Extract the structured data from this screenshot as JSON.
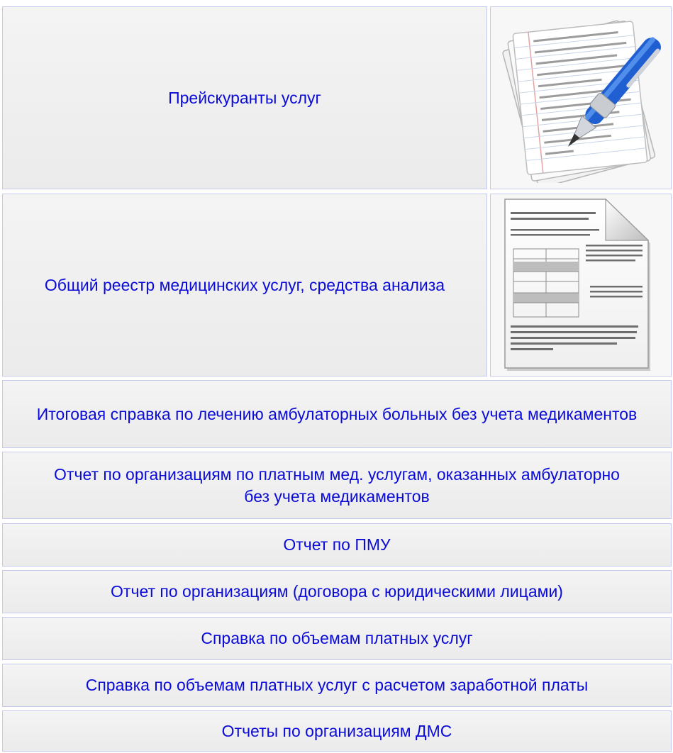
{
  "menu": {
    "items": [
      {
        "label": "Прейскуранты услуг"
      },
      {
        "label": "Общий реестр медицинских услуг, средства анализа"
      },
      {
        "label": "Итоговая справка по лечению амбулаторных больных без учета медикаментов"
      },
      {
        "label": "Отчет по организациям по платным мед. услугам, оказанных амбулаторно без учета медикаментов"
      },
      {
        "label": "Отчет по ПМУ"
      },
      {
        "label": "Отчет по организациям (договора с юридическими лицами)"
      },
      {
        "label": "Справка по объемам платных услуг"
      },
      {
        "label": "Справка по объемам платных услуг с расчетом заработной платы"
      },
      {
        "label": "Отчеты по организациям ДМС"
      }
    ]
  },
  "icons": {
    "pricelist_icon": "notepad-pen-icon",
    "registry_icon": "document-icon"
  },
  "colors": {
    "link_text": "#0b0bd8",
    "cell_border": "#c6c9ee",
    "cell_bg": "#efefef"
  }
}
